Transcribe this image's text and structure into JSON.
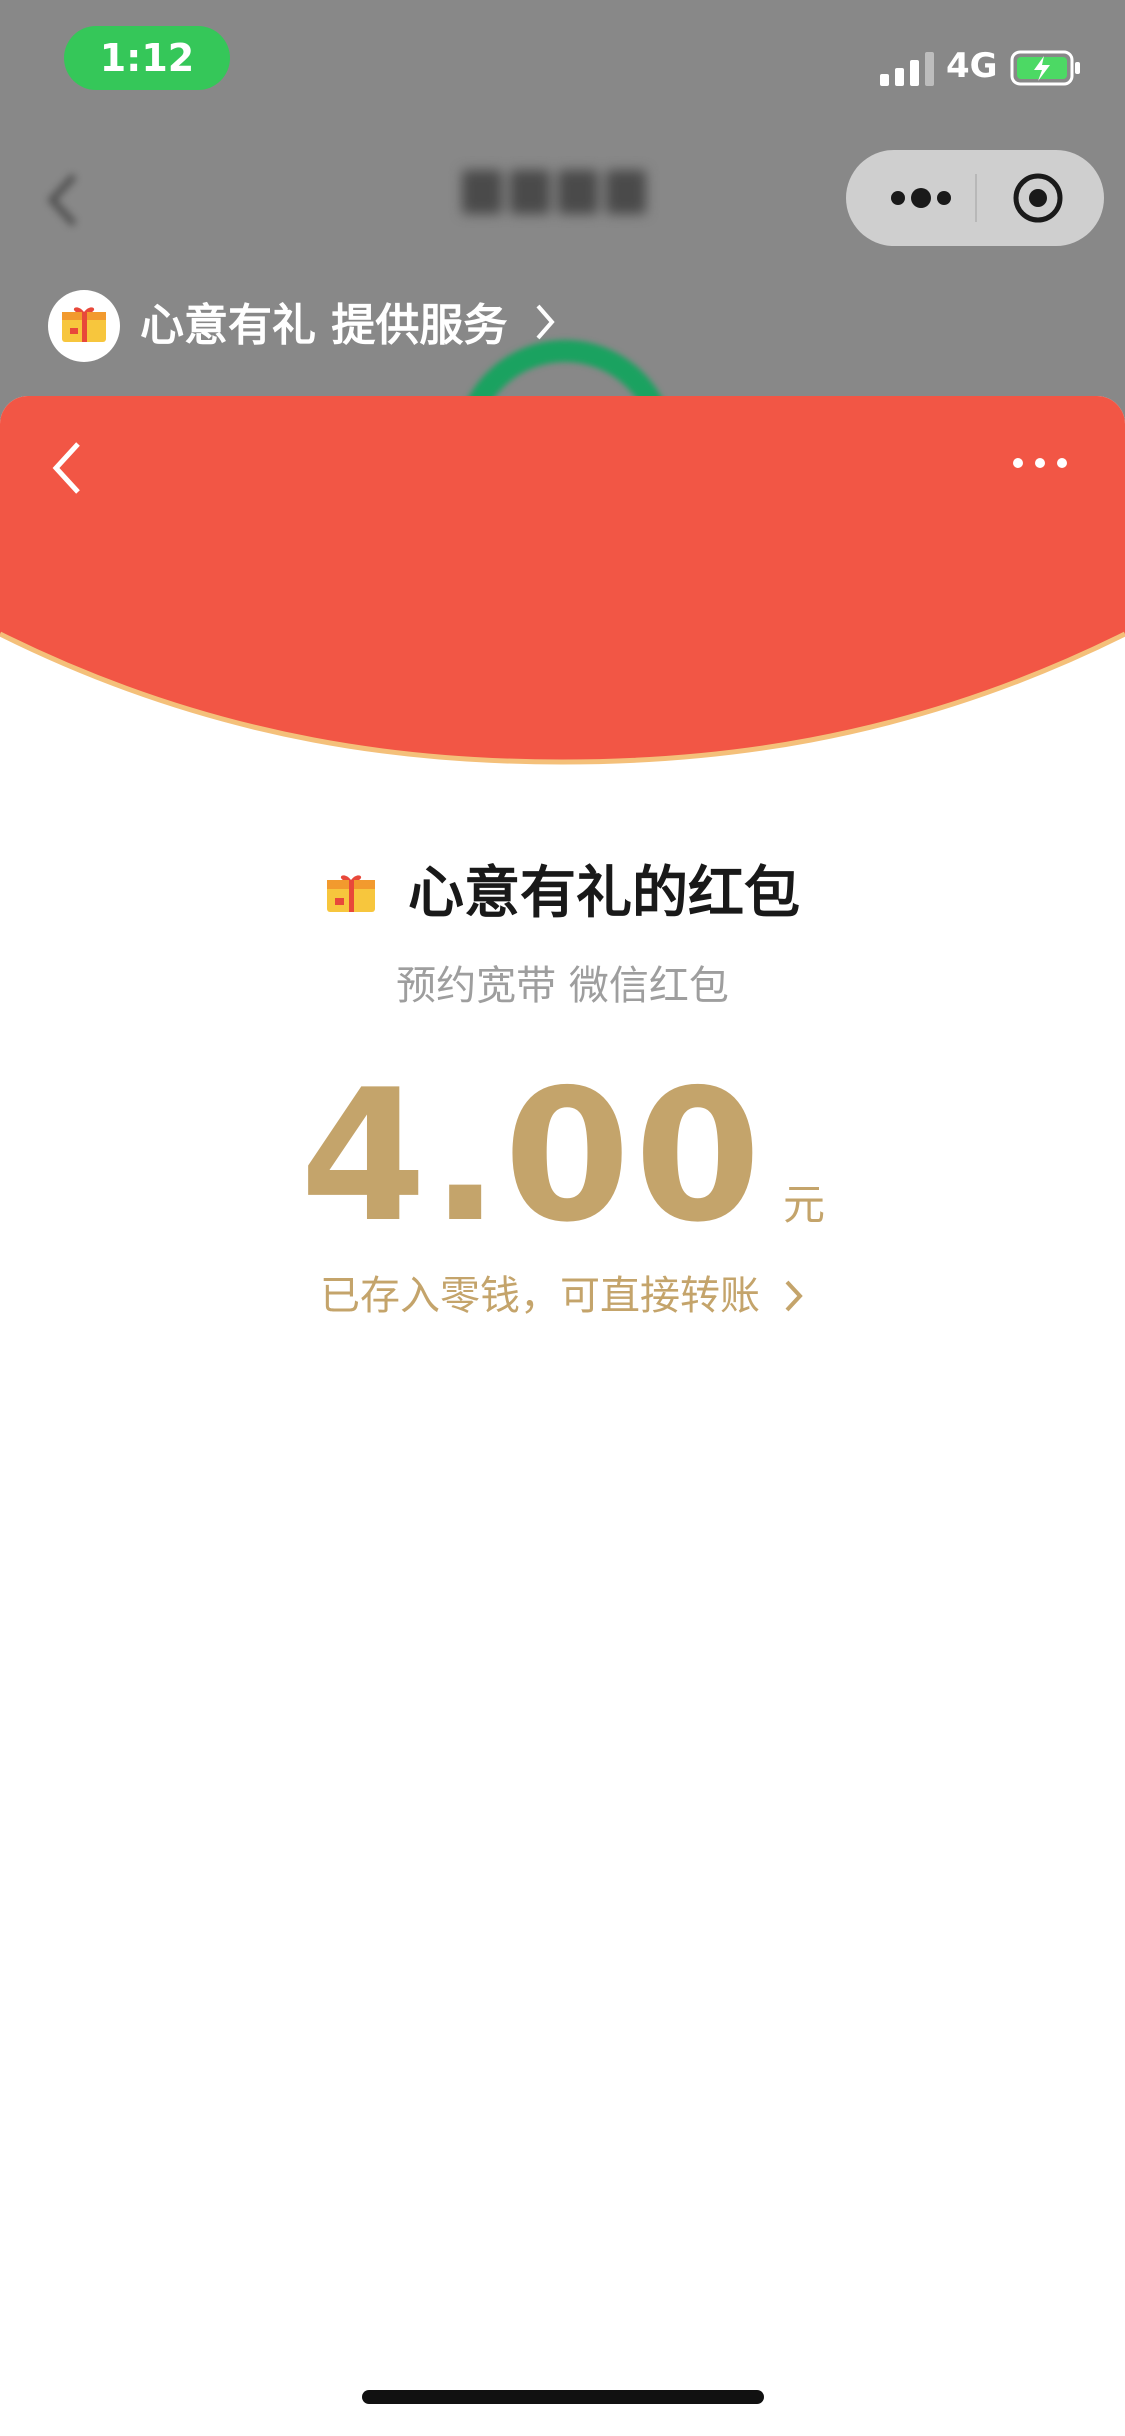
{
  "status_bar": {
    "time": "1:12",
    "network": "4G",
    "signal_icon": "signal-bars-icon",
    "battery_icon": "battery-charging-icon"
  },
  "mini_program": {
    "capsule": {
      "more_icon": "more-dots-icon",
      "close_icon": "target-close-icon"
    },
    "provider": {
      "label": "心意有礼 提供服务",
      "logo_icon": "gift-box-icon",
      "chevron_icon": "chevron-right-icon"
    }
  },
  "red_packet": {
    "back_icon": "chevron-left-icon",
    "more_icon": "more-horizontal-icon",
    "sender_title": "心意有礼的红包",
    "sender_icon": "gift-box-icon",
    "subtitle": "预约宽带 微信红包",
    "amount": "4.00",
    "unit": "元",
    "stored_text": "已存入零钱，可直接转账",
    "stored_chevron_icon": "chevron-right-icon"
  },
  "colors": {
    "overlay_gray": "#888888",
    "time_pill_green": "#35c759",
    "packet_red": "#f25645",
    "packet_edge": "#f4c07a",
    "gold_text": "#c4a46b",
    "subtitle_gray": "#9e9e9e"
  }
}
